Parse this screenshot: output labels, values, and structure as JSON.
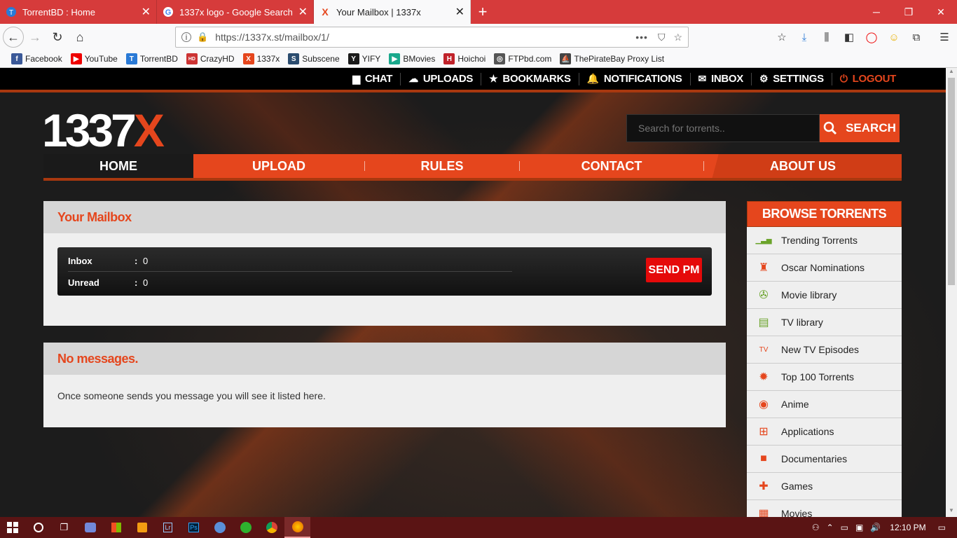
{
  "browser": {
    "tabs": [
      {
        "title": "TorrentBD : Home",
        "icon": "torrentbd-icon",
        "active": false
      },
      {
        "title": "1337x logo - Google Search",
        "icon": "google-icon",
        "active": false
      },
      {
        "title": "Your Mailbox | 1337x",
        "icon": "1337x-icon",
        "active": true
      }
    ],
    "url": "https://1337x.st/mailbox/1/",
    "bookmarks": [
      {
        "label": "Facebook",
        "icon": "facebook-icon",
        "color": "#3b5998",
        "glyph": "f"
      },
      {
        "label": "YouTube",
        "icon": "youtube-icon",
        "color": "#e00",
        "glyph": "▶"
      },
      {
        "label": "TorrentBD",
        "icon": "torrentbd-icon",
        "color": "#2a7ad6",
        "glyph": "T"
      },
      {
        "label": "CrazyHD",
        "icon": "crazyhd-icon",
        "color": "#c33",
        "glyph": "HD"
      },
      {
        "label": "1337x",
        "icon": "1337x-icon",
        "color": "#e5461d",
        "glyph": "X"
      },
      {
        "label": "Subscene",
        "icon": "subscene-icon",
        "color": "#2b4c6f",
        "glyph": "S"
      },
      {
        "label": "YIFY",
        "icon": "yify-icon",
        "color": "#1a1a1a",
        "glyph": "Y"
      },
      {
        "label": "BMovies",
        "icon": "bmovies-icon",
        "color": "#1aa88c",
        "glyph": "▶"
      },
      {
        "label": "Hoichoi",
        "icon": "hoichoi-icon",
        "color": "#c0222a",
        "glyph": "H"
      },
      {
        "label": "FTPbd.com",
        "icon": "globe-icon",
        "color": "#555",
        "glyph": "◎"
      },
      {
        "label": "ThePirateBay Proxy List",
        "icon": "pirate-ship-icon",
        "color": "#444",
        "glyph": "⛵"
      }
    ]
  },
  "site": {
    "toplinks": [
      {
        "label": "CHAT",
        "icon": "chat-icon",
        "glyph": "▆"
      },
      {
        "label": "UPLOADS",
        "icon": "cloud-upload-icon",
        "glyph": "☁"
      },
      {
        "label": "BOOKMARKS",
        "icon": "star-icon",
        "glyph": "★"
      },
      {
        "label": "NOTIFICATIONS",
        "icon": "bell-icon",
        "glyph": "🔔"
      },
      {
        "label": "INBOX",
        "icon": "envelope-icon",
        "glyph": "✉"
      },
      {
        "label": "SETTINGS",
        "icon": "gear-icon",
        "glyph": "⚙"
      },
      {
        "label": "LOGOUT",
        "icon": "power-icon",
        "glyph": "⏻"
      }
    ],
    "logo_main": "1337",
    "logo_accent": "X",
    "search_placeholder": "Search for torrents..",
    "search_button": "SEARCH",
    "nav": [
      "HOME",
      "UPLOAD",
      "RULES",
      "CONTACT",
      "ABOUT US"
    ],
    "mailbox": {
      "title": "Your Mailbox",
      "inbox_label": "Inbox",
      "inbox_value": "0",
      "unread_label": "Unread",
      "unread_value": "0",
      "sep": ":",
      "send_button": "SEND PM"
    },
    "messages": {
      "title": "No messages.",
      "body": "Once someone sends you message you will see it listed here."
    },
    "browse": {
      "title": "BROWSE TORRENTS",
      "items": [
        {
          "label": "Trending Torrents",
          "icon": "trending-chart-icon",
          "glyph": "▁▃▅",
          "color": "#6aa32a"
        },
        {
          "label": "Oscar Nominations",
          "icon": "oscar-trophy-icon",
          "glyph": "♜",
          "color": "#e5461d"
        },
        {
          "label": "Movie library",
          "icon": "film-reel-icon",
          "glyph": "✇",
          "color": "#6aa32a"
        },
        {
          "label": "TV library",
          "icon": "tv-library-icon",
          "glyph": "▤",
          "color": "#6aa32a"
        },
        {
          "label": "New TV Episodes",
          "icon": "tv-icon",
          "glyph": "TV",
          "color": "#e5461d"
        },
        {
          "label": "Top 100 Torrents",
          "icon": "top-badge-icon",
          "glyph": "✹",
          "color": "#e5461d"
        },
        {
          "label": "Anime",
          "icon": "anime-icon",
          "glyph": "◉",
          "color": "#e5461d"
        },
        {
          "label": "Applications",
          "icon": "windows-logo-icon",
          "glyph": "⊞",
          "color": "#e5461d"
        },
        {
          "label": "Documentaries",
          "icon": "video-camera-icon",
          "glyph": "■",
          "color": "#e5461d"
        },
        {
          "label": "Games",
          "icon": "gamepad-icon",
          "glyph": "✚",
          "color": "#e5461d"
        },
        {
          "label": "Movies",
          "icon": "clapperboard-icon",
          "glyph": "▦",
          "color": "#e5461d"
        }
      ]
    }
  },
  "taskbar": {
    "time": "12:10 PM"
  }
}
